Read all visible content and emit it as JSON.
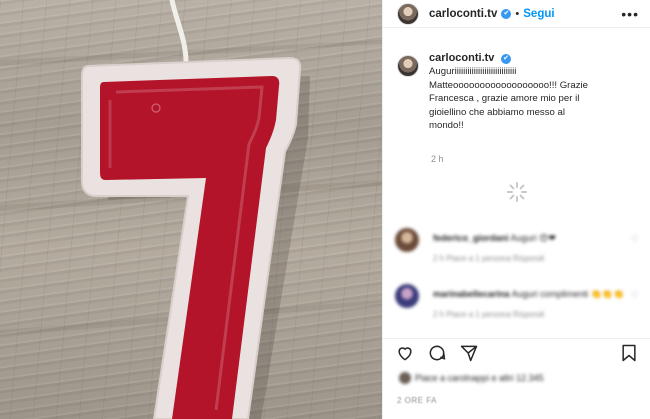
{
  "post": {
    "username": "carloconti.tv",
    "verified_mark": "✔",
    "separator": "•",
    "follow_label": "Segui",
    "more_glyph": "•••"
  },
  "caption": {
    "username": "carloconti.tv",
    "text": "Auguriiiiiiiiiiiiiiiiiiiiiiiiiiiii\nMatteoooooooooooooooooo!!! Grazie\nFrancesca , grazie amore mio per il\ngioiellino che abbiamo messo al\nmondo!!",
    "time": "2 h"
  },
  "comments": [
    {
      "user": "federico_giordani",
      "text": "Auguri 😍❤",
      "meta": "2 h   Piace a 1 persona   Rispondi"
    },
    {
      "user": "marinabellecarina",
      "text": "Auguri complimenti 👏👏👏",
      "meta": "2 h   Piace a 1 persona   Rispondi"
    }
  ],
  "likes_text": "Piace a carolnappi e altri 12.345",
  "date_text": "2 ORE FA",
  "icons": {
    "photo_subject": "candle-number-seven",
    "like": "heart-icon",
    "comment": "comment-icon",
    "share": "share-icon",
    "save": "bookmark-icon"
  },
  "colors": {
    "follow": "#0095f6",
    "verified": "#3897f0",
    "candle_red": "#b3142a",
    "candle_rim": "#e9dede"
  }
}
